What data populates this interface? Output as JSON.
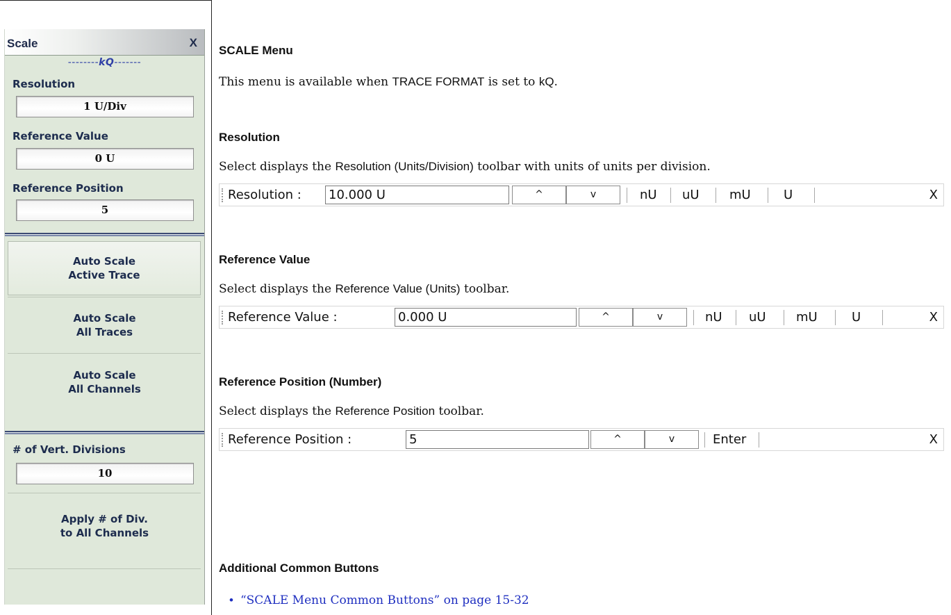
{
  "menu": {
    "title": "Scale",
    "close_label": "X",
    "subtitle_dashes_left": "--------",
    "subtitle": "kQ",
    "subtitle_dashes_right": "-------",
    "resolution_label": "Resolution",
    "resolution_value": "1 U/Div",
    "reference_value_label": "Reference Value",
    "reference_value_value": "0 U",
    "reference_position_label": "Reference Position",
    "reference_position_value": "5",
    "auto_scale_active_line1": "Auto Scale",
    "auto_scale_active_line2": "Active Trace",
    "auto_scale_all_traces_line1": "Auto Scale",
    "auto_scale_all_traces_line2": "All Traces",
    "auto_scale_all_channels_line1": "Auto Scale",
    "auto_scale_all_channels_line2": "All Channels",
    "vert_divisions_label": "# of Vert. Divisions",
    "vert_divisions_value": "10",
    "apply_div_line1": "Apply # of Div.",
    "apply_div_line2": "to All Channels"
  },
  "doc": {
    "scale_menu_heading": "SCALE Menu",
    "intro_pre": "This menu is available when ",
    "intro_trace_format": "TRACE FORMAT",
    "intro_mid": " is set to ",
    "intro_kq": "kQ",
    "intro_post": ".",
    "resolution_heading": "Resolution",
    "resolution_pre": "Select displays the ",
    "resolution_toolbar_name": "Resolution (Units/Division)",
    "resolution_post": " toolbar with units of units per division.",
    "reference_value_heading": "Reference Value",
    "reference_value_pre": "Select displays the ",
    "reference_value_toolbar_name": "Reference Value (Units)",
    "reference_value_post": " toolbar.",
    "reference_position_heading": "Reference Position (Number)",
    "reference_position_pre": "Select displays the ",
    "reference_position_toolbar_name": "Reference Position",
    "reference_position_post": " toolbar.",
    "additional_heading": "Additional Common Buttons",
    "bullet_dot": "•",
    "link_text": "“SCALE Menu Common Buttons” on page 15-32"
  },
  "toolbars": {
    "resolution": {
      "label": "Resolution  :",
      "value": "10.000  U",
      "up": "^",
      "down": "v",
      "units": [
        "nU",
        "uU",
        "mU",
        "U"
      ],
      "close": "X"
    },
    "reference_value": {
      "label": "Reference Value  :",
      "value": "0.000  U",
      "up": "^",
      "down": "v",
      "units": [
        "nU",
        "uU",
        "mU",
        "U"
      ],
      "close": "X"
    },
    "reference_position": {
      "label": "Reference Position  :",
      "value": "5",
      "up": "^",
      "down": "v",
      "enter": "Enter",
      "close": "X"
    }
  },
  "colors": {
    "menu_background": "#dfe8da",
    "menu_text": "#1d2c4e",
    "subtitle": "#2f3fa6",
    "link": "#1f2fc0"
  }
}
